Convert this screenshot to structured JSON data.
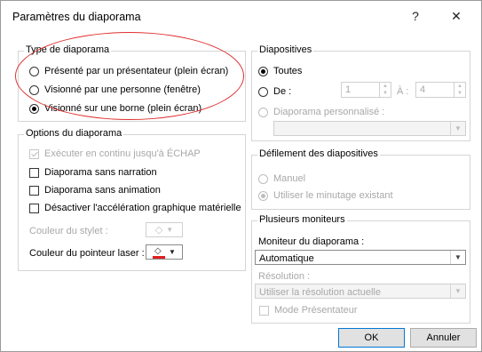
{
  "window": {
    "title": "Paramètres du diaporama",
    "help_glyph": "?",
    "close_glyph": "✕"
  },
  "type_diaporama": {
    "label": "Type de diaporama",
    "options": [
      {
        "label": "Présenté par un présentateur (plein écran)",
        "checked": false
      },
      {
        "label": "Visionné par une personne (fenêtre)",
        "checked": false
      },
      {
        "label": "Visionné sur une borne (plein écran)",
        "checked": true
      }
    ]
  },
  "options_diaporama": {
    "label": "Options du diaporama",
    "loop": "Exécuter en continu jusqu'à ÉCHAP",
    "no_narration": "Diaporama sans narration",
    "no_animation": "Diaporama sans animation",
    "disable_hw": "Désactiver l'accélération graphique matérielle",
    "pen_color": "Couleur du stylet :",
    "laser_color": "Couleur du pointeur laser :",
    "laser_color_value": "#e02020"
  },
  "diapositives": {
    "label": "Diapositives",
    "all": "Toutes",
    "from": "De :",
    "from_value": "1",
    "to": "À :",
    "to_value": "4",
    "custom": "Diaporama personnalisé :"
  },
  "defilement": {
    "label": "Défilement des diapositives",
    "manual": "Manuel",
    "timing": "Utiliser le minutage existant"
  },
  "moniteurs": {
    "label": "Plusieurs moniteurs",
    "monitor_label": "Moniteur du diaporama :",
    "monitor_value": "Automatique",
    "resolution_label": "Résolution :",
    "resolution_value": "Utiliser la résolution actuelle",
    "presenter_mode": "Mode Présentateur"
  },
  "buttons": {
    "ok": "OK",
    "cancel": "Annuler"
  }
}
